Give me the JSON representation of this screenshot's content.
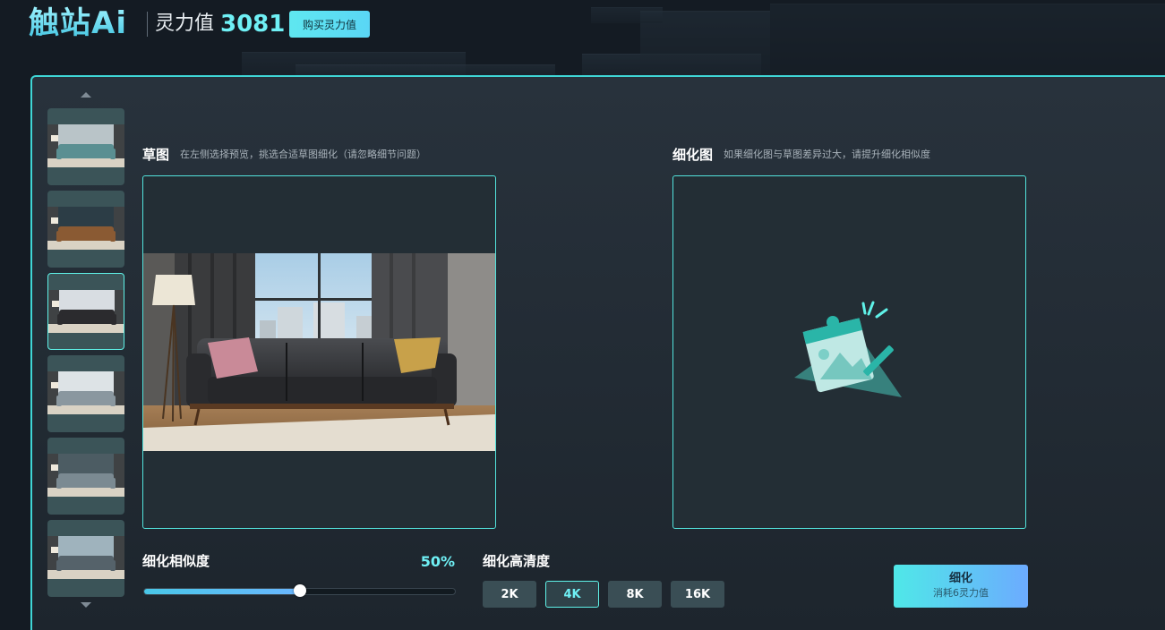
{
  "header": {
    "logo_text": "触站Ai",
    "power_label": "灵力值",
    "power_value": "3081",
    "buy_label": "购买灵力值"
  },
  "thumbnails": {
    "selected_index": 2,
    "items": [
      {
        "sofa": "#5a8f92",
        "wall": "#b9c4c8"
      },
      {
        "sofa": "#8a5a33",
        "wall": "#2c3d46"
      },
      {
        "sofa": "#2b2b2e",
        "wall": "#d8dde2"
      },
      {
        "sofa": "#8a979f",
        "wall": "#dde3e6"
      },
      {
        "sofa": "#7b8a92",
        "wall": "#4c5c63"
      },
      {
        "sofa": "#55626a",
        "wall": "#9fb3bd"
      }
    ]
  },
  "sketch": {
    "title": "草图",
    "hint": "在左侧选择预览，挑选合适草图细化（请忽略细节问题）"
  },
  "refined": {
    "title": "细化图",
    "hint": "如果细化图与草图差异过大，请提升细化相似度"
  },
  "controls": {
    "similarity_label": "细化相似度",
    "similarity_value": "50%",
    "similarity_fraction": 0.5,
    "resolution_label": "细化高清度",
    "resolutions": [
      "2K",
      "4K",
      "8K",
      "16K"
    ],
    "resolution_selected": 1,
    "refine_label": "细化",
    "refine_cost": "消耗6灵力值"
  },
  "colors": {
    "accent": "#5ff2e8",
    "brand_gradient_start": "#4fe8e8",
    "brand_gradient_end": "#6cabff",
    "panel_bg": "#232e35"
  },
  "icons": {
    "empty_state": "image-edit-icon",
    "thumb_up": "chevron-up-icon",
    "thumb_down": "chevron-down-icon"
  }
}
